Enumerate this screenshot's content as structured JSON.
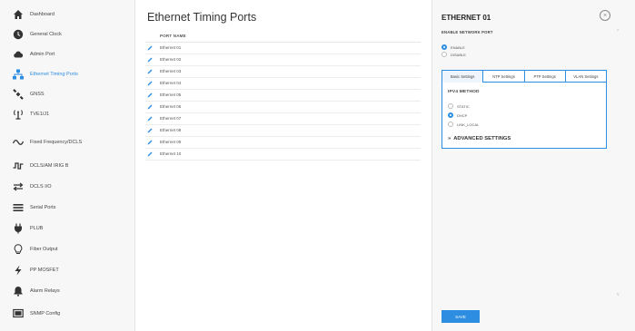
{
  "sidebar": {
    "items": [
      {
        "label": "Dashboard",
        "icon": "home-icon",
        "active": false
      },
      {
        "label": "General Clock",
        "icon": "clock-icon",
        "active": false
      },
      {
        "label": "Admin Port",
        "icon": "cloud-icon",
        "active": false
      },
      {
        "label": "Ethernet Timing Ports",
        "icon": "network-icon",
        "active": true
      },
      {
        "label": "GNSS",
        "icon": "satellite-icon",
        "active": false
      },
      {
        "label": "TVE1/J1",
        "icon": "antenna-icon",
        "active": false
      },
      {
        "label": "Fixed Frequency/DCLS",
        "icon": "wave-icon",
        "active": false
      },
      {
        "label": "DCLS/AM IRIG B",
        "icon": "pulse-icon",
        "active": false
      },
      {
        "label": "DCLS I/O",
        "icon": "arrows-icon",
        "active": false
      },
      {
        "label": "Serial Ports",
        "icon": "serial-icon",
        "active": false
      },
      {
        "label": "PLUB",
        "icon": "plug-icon",
        "active": false
      },
      {
        "label": "Fiber Output",
        "icon": "bulb-icon",
        "active": false
      },
      {
        "label": "PP MOSFET",
        "icon": "bolt-icon",
        "active": false
      },
      {
        "label": "Alarm Relays",
        "icon": "bell-icon",
        "active": false
      },
      {
        "label": "SNMP Config",
        "icon": "monitor-icon",
        "active": false
      }
    ]
  },
  "main": {
    "title": "Ethernet Timing Ports",
    "column_header": "PORT NAME",
    "ports": [
      "Ethernet 01",
      "Ethernet 02",
      "Ethernet 03",
      "Ethernet 04",
      "Ethernet 05",
      "Ethernet 06",
      "Ethernet 07",
      "Ethernet 08",
      "Ethernet 09",
      "Ethernet 10"
    ]
  },
  "panel": {
    "title": "ETHERNET 01",
    "close_icon": "×",
    "enable_section": "ENABLE NETWORK PORT",
    "enable_options": [
      {
        "label": "ENABLE",
        "selected": true
      },
      {
        "label": "DISABLE",
        "selected": false
      }
    ],
    "tabs": [
      {
        "label": "Basic Settings",
        "active": true
      },
      {
        "label": "NTP Settings",
        "active": false
      },
      {
        "label": "PTP Settings",
        "active": false
      },
      {
        "label": "VLAN Settings",
        "active": false
      }
    ],
    "ipv4_section": "IPV4 METHOD",
    "ipv4_options": [
      {
        "label": "STATIC",
        "selected": false
      },
      {
        "label": "DHCP",
        "selected": true
      },
      {
        "label": "LINK_LOCAL",
        "selected": false
      }
    ],
    "advanced_label": "ADVANCED SETTINGS",
    "advanced_chevron": "»",
    "save_label": "SAVE",
    "scroll_up": "^",
    "scroll_down": "v"
  },
  "colors": {
    "accent": "#2d8de0",
    "sidebar_bg": "#f7f7f7",
    "border": "#e3e3e3"
  }
}
